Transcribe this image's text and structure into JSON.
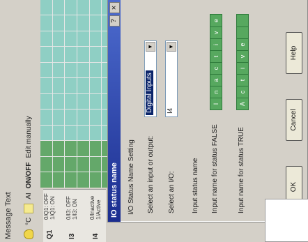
{
  "app": {
    "title": "Message Text"
  },
  "toolbar": {
    "unit": "°C",
    "ai": "AI",
    "onoff": "ON/OFF",
    "edit": "Edit manually"
  },
  "rows": [
    {
      "label": "Q1",
      "sub1": "0/Q1: OFF",
      "sub2": "1/Q1: ON"
    },
    {
      "label": "I3",
      "sub1": "0/I3: OFF",
      "sub2": "1/I3: ON"
    },
    {
      "label": "I4",
      "sub1": "0/Inactive",
      "sub2": "1/Active"
    }
  ],
  "dialog": {
    "title": "IO status name",
    "group": "I/O Status Name Setting",
    "select_io_label": "Select an input or output:",
    "select_io_value": "Digital Inputs",
    "select_io_no_label": "Select an I/O:",
    "select_io_no_value": "I4",
    "input_status_name_label": "Input status name",
    "false_label": "Input name for status FALSE",
    "false_letters": [
      "I",
      "n",
      "a",
      "c",
      "t",
      "i",
      "v",
      "e"
    ],
    "true_label": "Input name for status TRUE",
    "true_letters": [
      "A",
      "c",
      "t",
      "i",
      "v",
      "e",
      "",
      ""
    ],
    "ok": "OK",
    "cancel": "Cancel",
    "help": "Help"
  },
  "colors": {
    "grid_green": "#64a86a",
    "grid_teal": "#8fcfc4",
    "title_blue": "#1b2d8f"
  }
}
